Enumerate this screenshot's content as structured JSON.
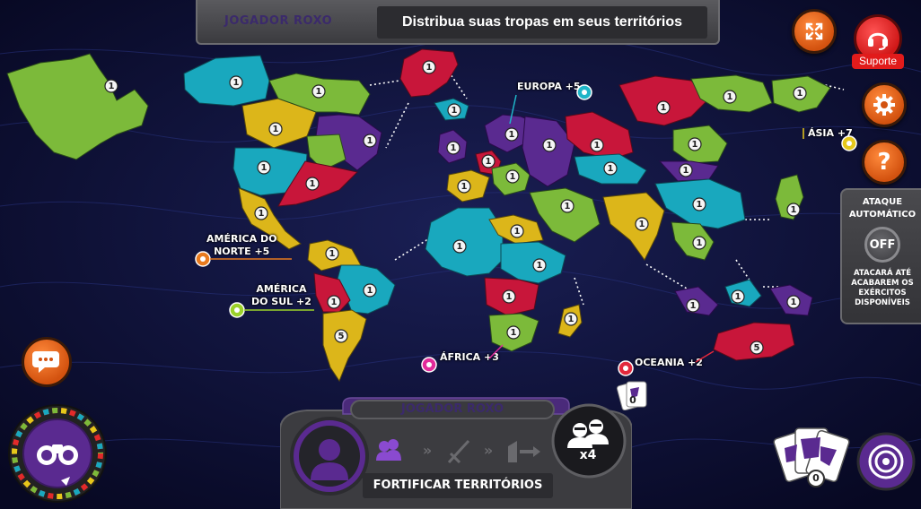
{
  "top_bar": {
    "player_name": "JOGADOR ROXO",
    "instruction": "Distribua suas tropas em seus territórios"
  },
  "support": {
    "label": "Suporte"
  },
  "continents": [
    {
      "id": "na",
      "label_line1": "AMÉRICA DO",
      "label_line2": "NORTE +5",
      "color": "#e87a1e"
    },
    {
      "id": "sa",
      "label_line1": "AMÉRICA",
      "label_line2": "DO SUL +2",
      "color": "#9bd22a"
    },
    {
      "id": "eu",
      "label_line1": "EUROPA +5",
      "label_line2": "",
      "color": "#1fb5c8"
    },
    {
      "id": "af",
      "label_line1": "ÁFRICA +3",
      "label_line2": "",
      "color": "#e22a9a"
    },
    {
      "id": "as",
      "label_line1": "ÁSIA +7",
      "label_line2": "",
      "color": "#e6c81a"
    },
    {
      "id": "oc",
      "label_line1": "OCEANIA +2",
      "label_line2": "",
      "color": "#e2283c"
    }
  ],
  "territories": [
    {
      "name": "alaska",
      "troops": "1",
      "color": "#7cba3a"
    },
    {
      "name": "northwest-territory",
      "troops": "1",
      "color": "#19a8be"
    },
    {
      "name": "greenland",
      "troops": "1",
      "color": "#c8163a"
    },
    {
      "name": "alberta",
      "troops": "1",
      "color": "#dcb61a"
    },
    {
      "name": "ontario",
      "troops": "1",
      "color": "#7cba3a"
    },
    {
      "name": "quebec",
      "troops": "1",
      "color": "#5a2a90"
    },
    {
      "name": "western-us",
      "troops": "1",
      "color": "#19a8be"
    },
    {
      "name": "eastern-us",
      "troops": "1",
      "color": "#c8163a"
    },
    {
      "name": "central-america",
      "troops": "1",
      "color": "#dcb61a"
    },
    {
      "name": "venezuela",
      "troops": "1",
      "color": "#dcb61a"
    },
    {
      "name": "brazil",
      "troops": "1",
      "color": "#19a8be"
    },
    {
      "name": "peru",
      "troops": "1",
      "color": "#c8163a"
    },
    {
      "name": "argentina",
      "troops": "5",
      "color": "#dcb61a"
    },
    {
      "name": "iceland",
      "troops": "1",
      "color": "#19a8be"
    },
    {
      "name": "great-britain",
      "troops": "1",
      "color": "#5a2a90"
    },
    {
      "name": "scandinavia",
      "troops": "1",
      "color": "#5a2a90"
    },
    {
      "name": "northern-europe",
      "troops": "1",
      "color": "#c8163a"
    },
    {
      "name": "western-europe",
      "troops": "1",
      "color": "#dcb61a"
    },
    {
      "name": "southern-europe",
      "troops": "1",
      "color": "#7cba3a"
    },
    {
      "name": "ukraine",
      "troops": "1",
      "color": "#5a2a90"
    },
    {
      "name": "north-africa",
      "troops": "1",
      "color": "#19a8be"
    },
    {
      "name": "egypt",
      "troops": "1",
      "color": "#dcb61a"
    },
    {
      "name": "east-africa",
      "troops": "1",
      "color": "#19a8be"
    },
    {
      "name": "congo",
      "troops": "1",
      "color": "#c8163a"
    },
    {
      "name": "south-africa",
      "troops": "1",
      "color": "#7cba3a"
    },
    {
      "name": "madagascar",
      "troops": "1",
      "color": "#dcb61a"
    },
    {
      "name": "ural",
      "troops": "1",
      "color": "#c8163a"
    },
    {
      "name": "siberia",
      "troops": "1",
      "color": "#c8163a"
    },
    {
      "name": "yakutsk",
      "troops": "1",
      "color": "#7cba3a"
    },
    {
      "name": "kamchatka",
      "troops": "1",
      "color": "#7cba3a"
    },
    {
      "name": "irkutsk",
      "troops": "1",
      "color": "#7cba3a"
    },
    {
      "name": "mongolia",
      "troops": "1",
      "color": "#5a2a90"
    },
    {
      "name": "afghanistan",
      "troops": "1",
      "color": "#19a8be"
    },
    {
      "name": "china",
      "troops": "1",
      "color": "#19a8be"
    },
    {
      "name": "middle-east",
      "troops": "1",
      "color": "#7cba3a"
    },
    {
      "name": "india",
      "troops": "1",
      "color": "#dcb61a"
    },
    {
      "name": "siam",
      "troops": "1",
      "color": "#7cba3a"
    },
    {
      "name": "japan",
      "troops": "1",
      "color": "#7cba3a"
    },
    {
      "name": "indonesia",
      "troops": "1",
      "color": "#5a2a90"
    },
    {
      "name": "new-guinea",
      "troops": "1",
      "color": "#19a8be"
    },
    {
      "name": "eastern-australia",
      "troops": "1",
      "color": "#5a2a90"
    },
    {
      "name": "western-australia",
      "troops": "5",
      "color": "#c8163a"
    }
  ],
  "auto_attack": {
    "title_line1": "ATAQUE",
    "title_line2": "AUTOMÁTICO",
    "state": "OFF",
    "description": "ATACARÁ ATÉ ACABAREM OS EXÉRCITOS DISPONÍVEIS"
  },
  "bottom_panel": {
    "player_name": "JOGADOR ROXO",
    "phase": "FORTIFICAR TERRITÓRIOS",
    "troops_available": "x4",
    "card_count_small": "0"
  },
  "cards": {
    "count": "0"
  },
  "colors": {
    "player": "#5a2a90",
    "accent_orange": "#e0601a",
    "support_red": "#e11b1b"
  }
}
